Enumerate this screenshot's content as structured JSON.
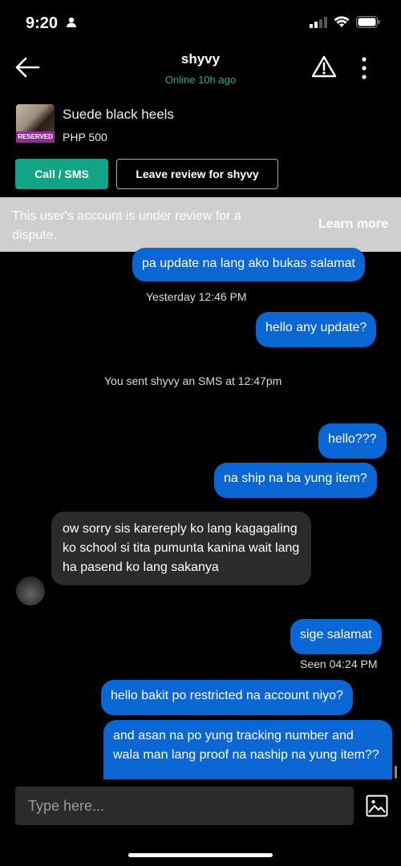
{
  "status": {
    "time": "9:20"
  },
  "header": {
    "title": "shyvy",
    "subtitle": "Online 10h ago"
  },
  "listing": {
    "title": "Suede black heels",
    "price": "PHP 500",
    "badge": "RESERVED"
  },
  "actions": {
    "call": "Call / SMS",
    "review": "Leave review for shyvy"
  },
  "banner": {
    "text": "This user's account is under review for a dispute.",
    "link": "Learn more"
  },
  "messages": [
    {
      "text": "pa update na lang ako bukas salamat",
      "dir": "out"
    },
    {
      "text": "Yesterday 12:46 PM",
      "dir": "meta"
    },
    {
      "text": "hello any update?",
      "dir": "out"
    },
    {
      "text": "You sent shyvy an SMS at 12:47pm",
      "dir": "meta"
    },
    {
      "text": "hello???",
      "dir": "out"
    },
    {
      "text": "na ship na ba yung item?",
      "dir": "out"
    },
    {
      "text": "ow sorry sis karereply ko lang kagagaling ko school si tita pumunta kanina wait lang ha pasend ko lang sakanya",
      "dir": "in"
    },
    {
      "text": "sige salamat",
      "dir": "out"
    },
    {
      "text": "Seen 04:24 PM",
      "dir": "meta"
    },
    {
      "text": "hello bakit po restricted na account niyo?",
      "dir": "out"
    },
    {
      "text": "and asan na po yung tracking number and wala man lang proof na naship na yung item??",
      "dir": "out"
    }
  ],
  "composer": {
    "placeholder": "Type here..."
  },
  "colors": {
    "accent": "#13a386",
    "outgoing": "#0a66d3",
    "incoming": "#2b2b2e",
    "online": "#19b188",
    "badge": "#8e2e8f"
  }
}
